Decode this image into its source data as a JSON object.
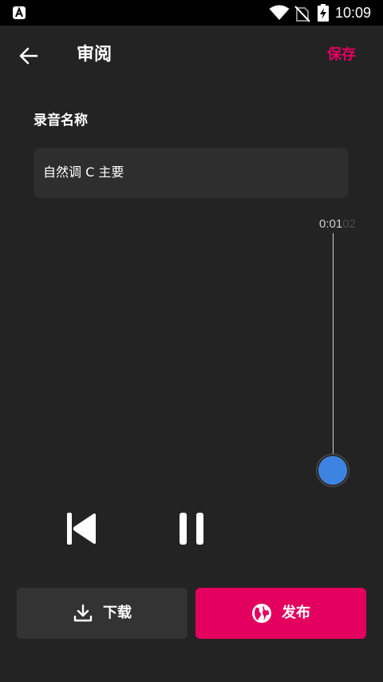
{
  "status_bar": {
    "time": "10:09",
    "icons": [
      "app-notification-icon",
      "wifi-icon",
      "no-sim-icon",
      "battery-charging-icon"
    ]
  },
  "header": {
    "title": "审阅",
    "save_label": "保存",
    "back_icon": "arrow-left-icon"
  },
  "recording": {
    "name_label": "录音名称",
    "name_value": "自然调 C 主要"
  },
  "timeline": {
    "current_time": "0:01",
    "faded_time": "02"
  },
  "controls": {
    "skip_back_icon": "skip-to-start-icon",
    "pause_icon": "pause-icon"
  },
  "actions": {
    "download_label": "下载",
    "download_icon": "download-icon",
    "publish_label": "发布",
    "publish_icon": "globe-icon"
  },
  "colors": {
    "accent": "#e3005f",
    "background": "#232323",
    "field": "#2e2e2e",
    "secondary_button": "#333333",
    "thumb": "#3d84e0"
  }
}
